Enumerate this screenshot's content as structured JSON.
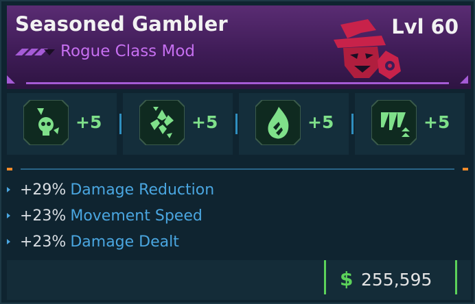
{
  "item": {
    "name": "Seasoned Gambler",
    "type": "Rogue Class Mod",
    "level": "Lvl 60",
    "rarity_color": "#a55bd6"
  },
  "skills": [
    {
      "icon": "skull-skill-icon",
      "bonus": "+5"
    },
    {
      "icon": "spiral-skill-icon",
      "bonus": "+5"
    },
    {
      "icon": "flame-skill-icon",
      "bonus": "+5"
    },
    {
      "icon": "claw-skill-icon",
      "bonus": "+5"
    }
  ],
  "stats": [
    {
      "value": "+29%",
      "name": "Damage Reduction"
    },
    {
      "value": "+23%",
      "name": "Movement Speed"
    },
    {
      "value": "+23%",
      "name": "Damage Dealt"
    }
  ],
  "price": {
    "icon": "dollar-icon",
    "value": "255,595"
  },
  "colors": {
    "stat_name": "#4aa6e0",
    "skill_bonus": "#7fe08a",
    "price_accent": "#5cd25a",
    "subtitle": "#c66ff0"
  }
}
